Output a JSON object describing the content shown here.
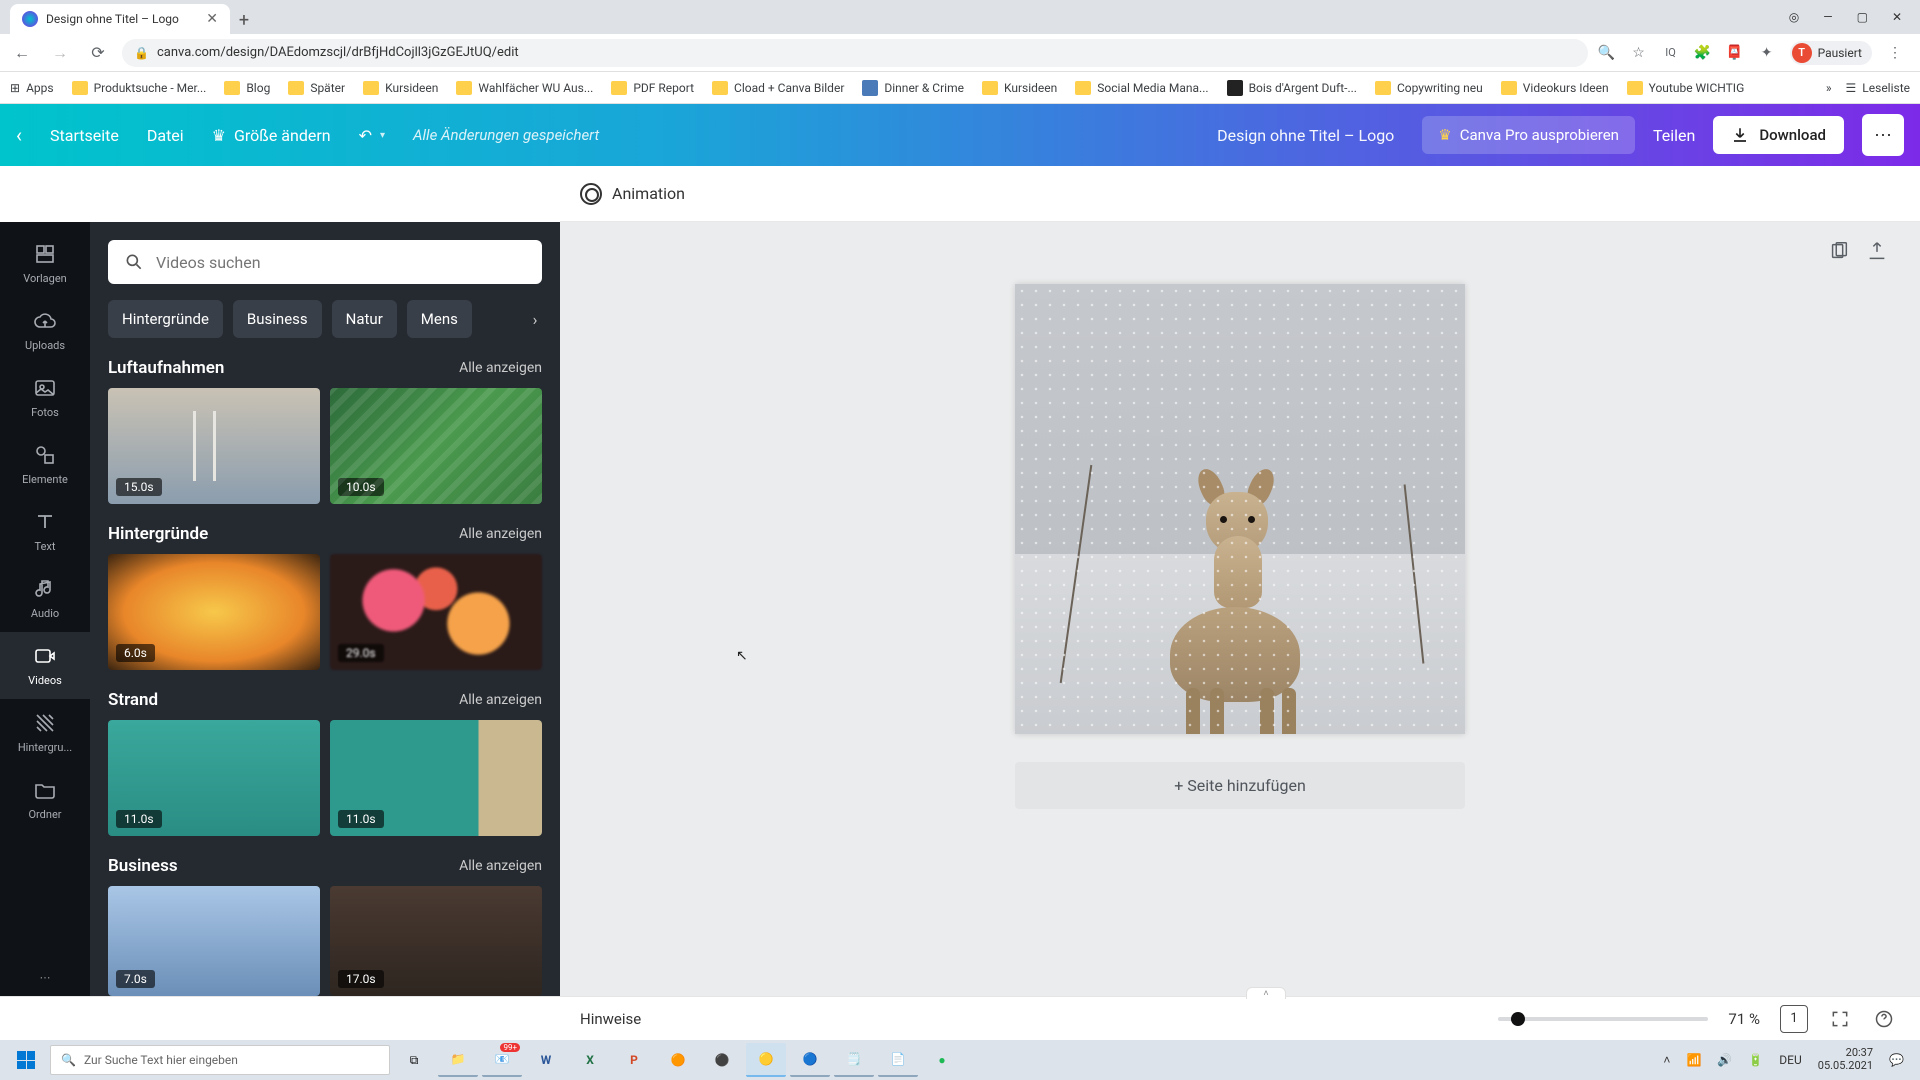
{
  "browser": {
    "tab_title": "Design ohne Titel – Logo",
    "url": "canva.com/design/DAEdomzscjl/drBfjHdCojll3jGzGEJtUQ/edit",
    "profile_label": "Pausiert",
    "profile_initial": "T"
  },
  "bookmarks": {
    "apps": "Apps",
    "items": [
      "Produktsuche - Mer...",
      "Blog",
      "Später",
      "Kursideen",
      "Wahlfächer WU Aus...",
      "PDF Report",
      "Cload + Canva Bilder",
      "Dinner & Crime",
      "Kursideen",
      "Social Media Mana...",
      "Bois d'Argent Duft-...",
      "Copywriting neu",
      "Videokurs Ideen",
      "Youtube WICHTIG"
    ],
    "reading_list": "Leseliste"
  },
  "topbar": {
    "home": "Startseite",
    "file": "Datei",
    "resize": "Größe ändern",
    "saved": "Alle Änderungen gespeichert",
    "doc_title": "Design ohne Titel – Logo",
    "pro": "Canva Pro ausprobieren",
    "share": "Teilen",
    "download": "Download"
  },
  "subtoolbar": {
    "animation": "Animation"
  },
  "rail": {
    "items": [
      "Vorlagen",
      "Uploads",
      "Fotos",
      "Elemente",
      "Text",
      "Audio",
      "Videos",
      "Hintergru...",
      "Ordner"
    ],
    "active_index": 6
  },
  "panel": {
    "search_placeholder": "Videos suchen",
    "filters": [
      "Hintergründe",
      "Business",
      "Natur",
      "Mens"
    ],
    "sections": [
      {
        "title": "Luftaufnahmen",
        "all": "Alle anzeigen",
        "thumbs": [
          {
            "dur": "15.0s"
          },
          {
            "dur": "10.0s"
          }
        ]
      },
      {
        "title": "Hintergründe",
        "all": "Alle anzeigen",
        "thumbs": [
          {
            "dur": "6.0s"
          },
          {
            "dur": "29.0s"
          }
        ]
      },
      {
        "title": "Strand",
        "all": "Alle anzeigen",
        "thumbs": [
          {
            "dur": "11.0s"
          },
          {
            "dur": "11.0s"
          }
        ]
      },
      {
        "title": "Business",
        "all": "Alle anzeigen",
        "thumbs": [
          {
            "dur": "7.0s"
          },
          {
            "dur": "17.0s"
          }
        ]
      }
    ]
  },
  "canvas": {
    "add_page": "+ Seite hinzufügen"
  },
  "bottombar": {
    "hints": "Hinweise",
    "zoom": "71 %",
    "pages": "1"
  },
  "taskbar": {
    "search_placeholder": "Zur Suche Text hier eingeben",
    "lang": "DEU",
    "time": "20:37",
    "date": "05.05.2021",
    "notif": "99+"
  }
}
